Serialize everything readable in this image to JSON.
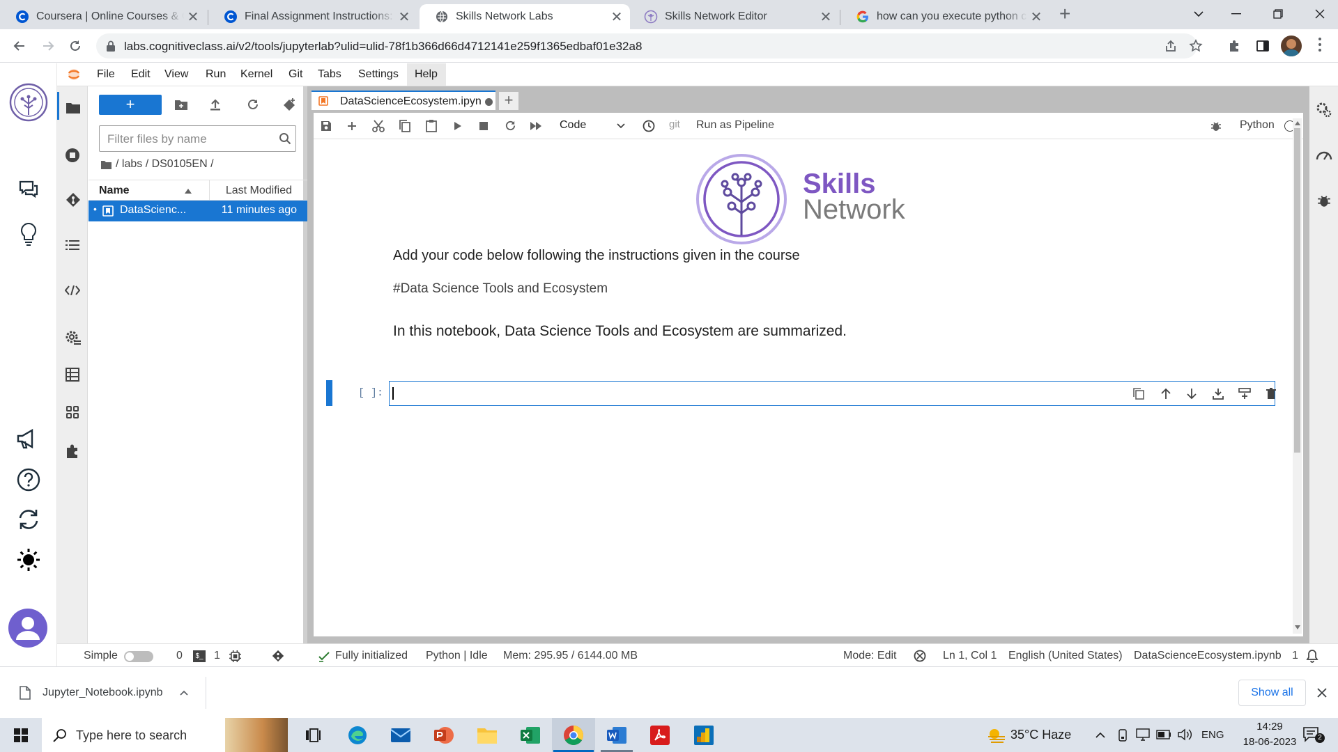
{
  "browser": {
    "tabs": [
      {
        "title": "Coursera | Online Courses & Cred"
      },
      {
        "title": "Final Assignment Instructions: Cr"
      },
      {
        "title": "Skills Network Labs"
      },
      {
        "title": "Skills Network Editor"
      },
      {
        "title": "how can you execute python cod"
      }
    ],
    "url": "labs.cognitiveclass.ai/v2/tools/jupyterlab?ulid=ulid-78f1b366d66d4712141e259f1365edbaf01e32a8"
  },
  "menu": [
    "File",
    "Edit",
    "View",
    "Run",
    "Kernel",
    "Git",
    "Tabs",
    "Settings",
    "Help"
  ],
  "filebrowser": {
    "new_label": "+",
    "filter_placeholder": "Filter files by name",
    "breadcrumb": "/ labs / DS0105EN /",
    "col_name": "Name",
    "col_modified": "Last Modified",
    "file_name": "DataScienc...",
    "file_modified": "11 minutes ago"
  },
  "notebook": {
    "tab_title": "DataScienceEcosystem.ipyn",
    "celltype": "Code",
    "git_label": "git",
    "pipeline_label": "Run as Pipeline",
    "kernel_label": "Python",
    "logo_line1": "Skills",
    "logo_line2": "Network",
    "md1": "Add your code below following the instructions given in the course",
    "md2": "#Data Science Tools and Ecosystem",
    "md3": "In this notebook, Data Science Tools and Ecosystem are summarized.",
    "prompt": "[ ]:"
  },
  "status": {
    "simple": "Simple",
    "terms": "0",
    "kernels": "1",
    "init": "Fully initialized",
    "kernel": "Python | Idle",
    "mem": "Mem: 295.95 / 6144.00 MB",
    "mode": "Mode: Edit",
    "cursor": "Ln 1, Col 1",
    "lang": "English (United States)",
    "file": "DataScienceEcosystem.ipynb",
    "notif": "1"
  },
  "downloads": {
    "file": "Jupyter_Notebook.ipynb",
    "show_all": "Show all"
  },
  "taskbar": {
    "search": "Type here to search",
    "weather": "35°C  Haze",
    "lang": "ENG",
    "time": "14:29",
    "date": "18-06-2023"
  },
  "colors": {
    "accent": "#1976d2",
    "brand": "#6f3fc8",
    "tab_bar": "#dee1e6"
  }
}
